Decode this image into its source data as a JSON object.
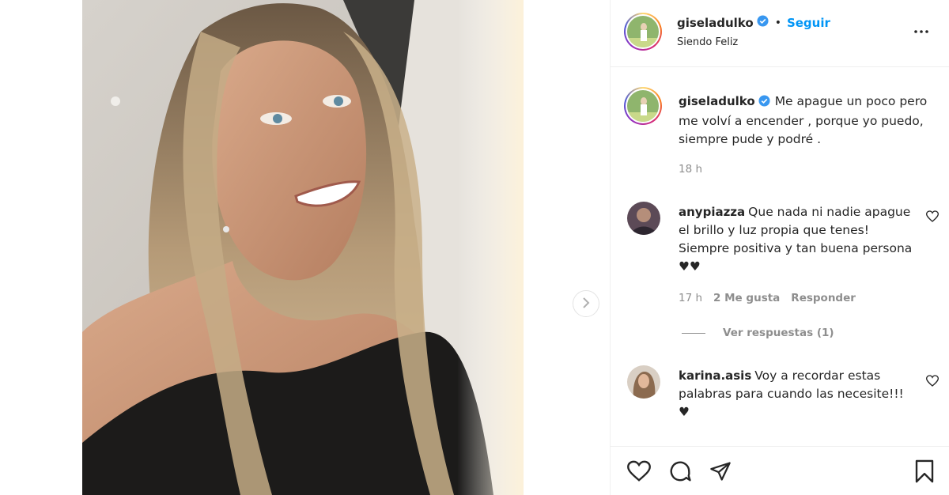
{
  "header": {
    "username": "giseladulko",
    "separator": "•",
    "follow_label": "Seguir",
    "location": "Siendo Feliz"
  },
  "caption": {
    "username": "giseladulko",
    "text": "Me apague un poco pero me volví a encender , porque yo puedo, siempre pude y podré .",
    "time": "18 h"
  },
  "comments": [
    {
      "username": "anypiazza",
      "text": "Que nada ni nadie apague el brillo y luz propia que tenes! Siempre positiva y tan buena persona ♥♥",
      "time": "17 h",
      "likes": "2 Me gusta",
      "reply_label": "Responder",
      "view_replies": "Ver respuestas (1)"
    },
    {
      "username": "karina.asis",
      "text": "Voy a recordar estas palabras para cuando las necesite!!! ♥"
    }
  ],
  "icons": {
    "verified": "verified-badge-icon",
    "more": "more-options-icon",
    "next": "chevron-right-icon",
    "like": "heart-icon",
    "comment": "comment-icon",
    "share": "paper-plane-icon",
    "save": "bookmark-icon"
  },
  "colors": {
    "accent": "#0095f6",
    "text": "#262626",
    "muted": "#8e8e8e",
    "border": "#efefef"
  }
}
